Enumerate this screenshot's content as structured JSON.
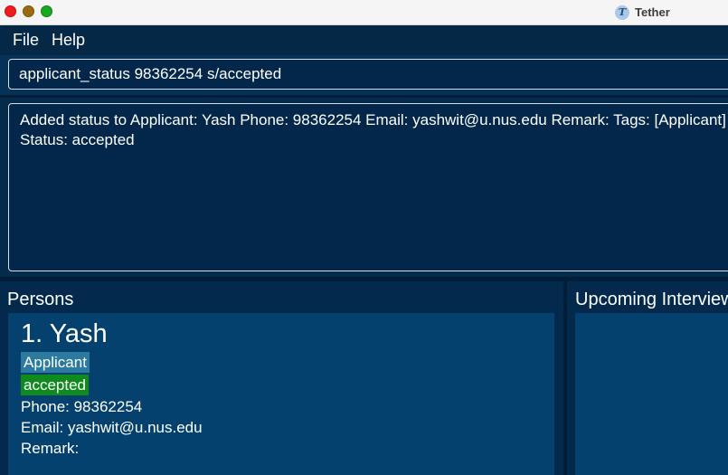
{
  "window": {
    "title": "Tether"
  },
  "menu": {
    "items": [
      "File",
      "Help"
    ]
  },
  "command": {
    "value": "applicant_status 98362254 s/accepted"
  },
  "result": {
    "lines": [
      "Added status to Applicant: Yash Phone: 98362254 Email: yashwit@u.nus.edu Remark:  Tags: [Applicant]",
      "Status: accepted"
    ]
  },
  "persons": {
    "title": "Persons",
    "items": [
      {
        "name": "1. Yash",
        "tag": "Applicant",
        "status": "accepted",
        "phone": "Phone: 98362254",
        "email": "Email: yashwit@u.nus.edu",
        "remark": "Remark:"
      }
    ]
  },
  "interviews": {
    "title": "Upcoming Interviews"
  },
  "colors": {
    "background": "#04284a",
    "card": "#05416e",
    "tag_applicant": "#2d7aa0",
    "tag_status": "#0e8a1e"
  }
}
